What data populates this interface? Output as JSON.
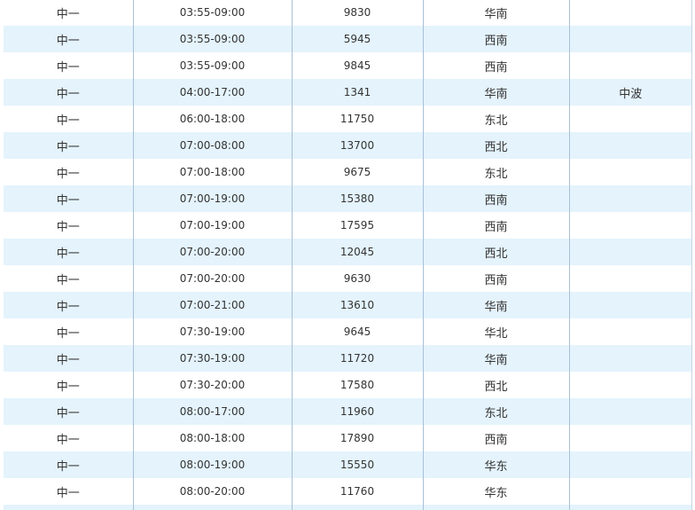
{
  "schedule": {
    "rows": [
      {
        "language": "中一",
        "time": "03:55-09:00",
        "frequency": "9830",
        "region": "华南",
        "remark": ""
      },
      {
        "language": "中一",
        "time": "03:55-09:00",
        "frequency": "5945",
        "region": "西南",
        "remark": ""
      },
      {
        "language": "中一",
        "time": "03:55-09:00",
        "frequency": "9845",
        "region": "西南",
        "remark": ""
      },
      {
        "language": "中一",
        "time": "04:00-17:00",
        "frequency": "1341",
        "region": "华南",
        "remark": "中波"
      },
      {
        "language": "中一",
        "time": "06:00-18:00",
        "frequency": "11750",
        "region": "东北",
        "remark": ""
      },
      {
        "language": "中一",
        "time": "07:00-08:00",
        "frequency": "13700",
        "region": "西北",
        "remark": ""
      },
      {
        "language": "中一",
        "time": "07:00-18:00",
        "frequency": "9675",
        "region": "东北",
        "remark": ""
      },
      {
        "language": "中一",
        "time": "07:00-19:00",
        "frequency": "15380",
        "region": "西南",
        "remark": ""
      },
      {
        "language": "中一",
        "time": "07:00-19:00",
        "frequency": "17595",
        "region": "西南",
        "remark": ""
      },
      {
        "language": "中一",
        "time": "07:00-20:00",
        "frequency": "12045",
        "region": "西北",
        "remark": ""
      },
      {
        "language": "中一",
        "time": "07:00-20:00",
        "frequency": "9630",
        "region": "西南",
        "remark": ""
      },
      {
        "language": "中一",
        "time": "07:00-21:00",
        "frequency": "13610",
        "region": "华南",
        "remark": ""
      },
      {
        "language": "中一",
        "time": "07:30-19:00",
        "frequency": "9645",
        "region": "华北",
        "remark": ""
      },
      {
        "language": "中一",
        "time": "07:30-19:00",
        "frequency": "11720",
        "region": "华南",
        "remark": ""
      },
      {
        "language": "中一",
        "time": "07:30-20:00",
        "frequency": "17580",
        "region": "西北",
        "remark": ""
      },
      {
        "language": "中一",
        "time": "08:00-17:00",
        "frequency": "11960",
        "region": "东北",
        "remark": ""
      },
      {
        "language": "中一",
        "time": "08:00-18:00",
        "frequency": "17890",
        "region": "西南",
        "remark": ""
      },
      {
        "language": "中一",
        "time": "08:00-19:00",
        "frequency": "15550",
        "region": "华东",
        "remark": ""
      },
      {
        "language": "中一",
        "time": "08:00-20:00",
        "frequency": "11760",
        "region": "华东",
        "remark": ""
      },
      {
        "language": "",
        "time": "",
        "frequency": "",
        "region": "",
        "remark": ""
      }
    ],
    "colors": {
      "stripe": "#e4f3fc",
      "divider": "#a9c0d6",
      "text": "#333333"
    }
  }
}
